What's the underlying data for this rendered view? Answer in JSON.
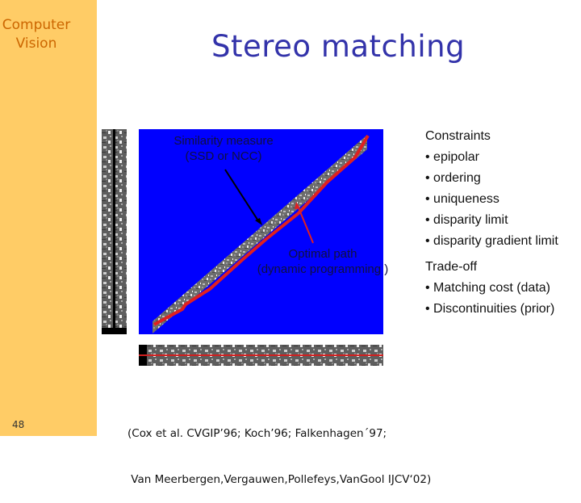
{
  "sidebar": {
    "course_title_line1": "Computer",
    "course_title_line2": "Vision",
    "page_number": "48",
    "color": "#FFCC66",
    "text_color": "#CC6600"
  },
  "slide": {
    "title": "Stereo matching",
    "title_color": "#3333AA"
  },
  "figure": {
    "panel_color": "#0000FF",
    "path_color": "#E02020",
    "label_similarity_line1": "Similarity measure",
    "label_similarity_line2": "(SSD or NCC)",
    "label_optimal_line1": "Optimal path",
    "label_optimal_line2": "(dynamic programming )"
  },
  "constraints": {
    "heading": "Constraints",
    "items": [
      "• epipolar",
      "• ordering",
      "• uniqueness",
      "• disparity limit",
      "• disparity gradient limit"
    ]
  },
  "tradeoff": {
    "heading": "Trade-off",
    "items": [
      "• Matching cost (data)",
      "• Discontinuities (prior)"
    ]
  },
  "citation": {
    "line1": "(Cox et al. CVGIP’96; Koch’96; Falkenhagen´97;",
    "line2": " Van Meerbergen,Vergauwen,Pollefeys,VanGool IJCV‘02)"
  }
}
